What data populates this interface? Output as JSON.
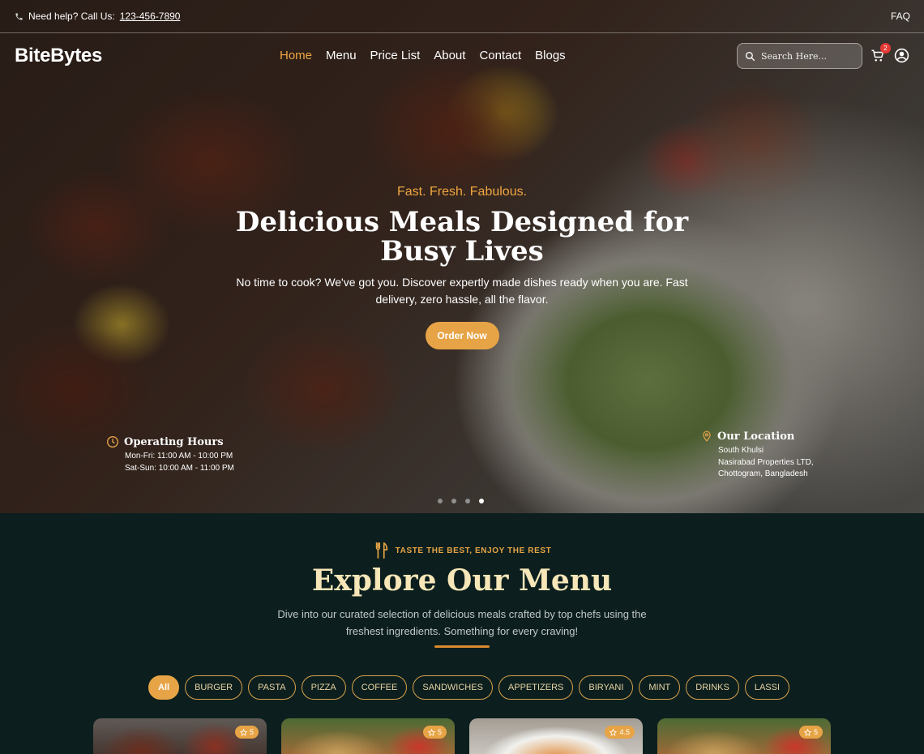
{
  "topbar": {
    "help_text": "Need help? Call Us:",
    "phone": "123-456-7890",
    "faq": "FAQ"
  },
  "header": {
    "logo": "BiteBytes",
    "nav": [
      "Home",
      "Menu",
      "Price List",
      "About",
      "Contact",
      "Blogs"
    ],
    "active_nav": "Home",
    "search_placeholder": "Search Here...",
    "cart_count": "2"
  },
  "hero": {
    "tagline": "Fast. Fresh. Fabulous.",
    "title": "Delicious Meals Designed for Busy Lives",
    "subtitle": "No time to cook? We've got you. Discover expertly made dishes ready when you are. Fast delivery, zero hassle, all the flavor.",
    "cta": "Order Now",
    "hours": {
      "title": "Operating Hours",
      "lines": [
        "Mon-Fri: 11:00 AM - 10:00 PM",
        "Sat-Sun: 10:00 AM - 11:00 PM"
      ]
    },
    "location": {
      "title": "Our Location",
      "lines": [
        "South Khulsi",
        "Nasirabad Properties LTD,",
        "Chottogram, Bangladesh"
      ]
    },
    "slides": 4,
    "active_slide": 4
  },
  "menu": {
    "kicker": "TASTE THE BEST, ENJOY THE REST",
    "title": "Explore Our Menu",
    "description": "Dive into our curated selection of delicious meals crafted by top chefs using the freshest ingredients. Something for every craving!",
    "filters": [
      "All",
      "BURGER",
      "PASTA",
      "PIZZA",
      "COFFEE",
      "SANDWICHES",
      "APPETIZERS",
      "BIRYANI",
      "MINT",
      "DRINKS",
      "LASSI"
    ],
    "active_filter": "All",
    "cards": [
      {
        "rating": "5"
      },
      {
        "rating": "5"
      },
      {
        "rating": "4.5"
      },
      {
        "rating": "5"
      }
    ]
  },
  "colors": {
    "accent": "#e7a446",
    "dark_bg": "#0c1f1e",
    "title_cream": "#f6e6b8",
    "badge_red": "#e53935"
  }
}
